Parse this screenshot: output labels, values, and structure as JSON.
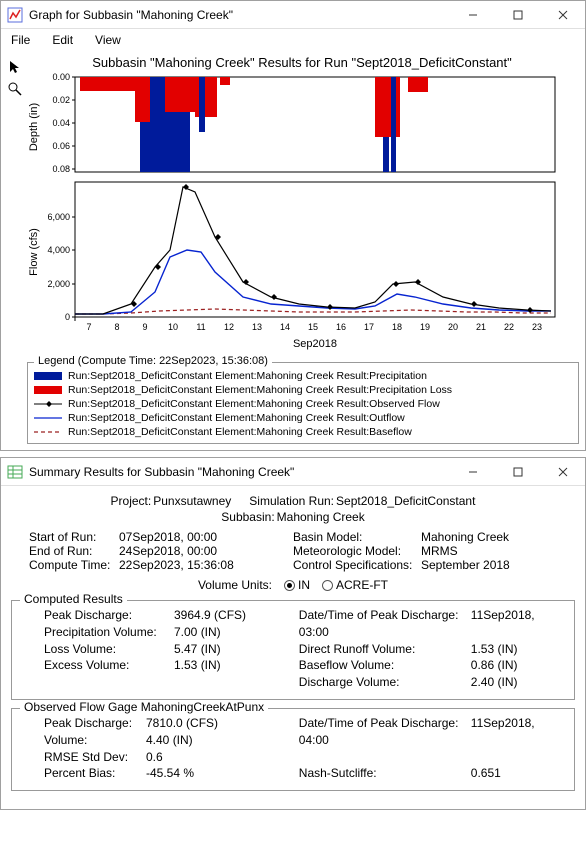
{
  "graph_window": {
    "title": "Graph for Subbasin \"Mahoning Creek\"",
    "menu": {
      "file": "File",
      "edit": "Edit",
      "view": "View"
    },
    "chart_title": "Subbasin \"Mahoning Creek\" Results for Run \"Sept2018_DeficitConstant\"",
    "depth_axis_label": "Depth (in)",
    "flow_axis_label": "Flow (cfs)",
    "x_axis_label": "Sep2018",
    "legend_title": "Legend (Compute Time: 22Sep2023, 15:36:08)",
    "legend": [
      {
        "label": "Run:Sept2018_DeficitConstant Element:Mahoning Creek Result:Precipitation",
        "color": "#001b9b",
        "style": "thick"
      },
      {
        "label": "Run:Sept2018_DeficitConstant Element:Mahoning Creek Result:Precipitation Loss",
        "color": "#e20000",
        "style": "thick"
      },
      {
        "label": "Run:Sept2018_DeficitConstant Element:Mahoning Creek Result:Observed Flow",
        "color": "#000000",
        "style": "diamond"
      },
      {
        "label": "Run:Sept2018_DeficitConstant Element:Mahoning Creek Result:Outflow",
        "color": "#0724d0",
        "style": "line"
      },
      {
        "label": "Run:Sept2018_DeficitConstant Element:Mahoning Creek Result:Baseflow",
        "color": "#9b2020",
        "style": "dash"
      }
    ]
  },
  "summary_window": {
    "title": "Summary Results for Subbasin \"Mahoning Creek\"",
    "header": {
      "project_label": "Project:",
      "project": "Punxsutawney",
      "simrun_label": "Simulation Run:",
      "simrun": "Sept2018_DeficitConstant",
      "subbasin_label": "Subbasin:",
      "subbasin": "Mahoning Creek"
    },
    "runinfo_left": {
      "start_label": "Start of Run:",
      "start": "07Sep2018, 00:00",
      "end_label": "End of Run:",
      "end": "24Sep2018, 00:00",
      "compute_label": "Compute Time:",
      "compute": "22Sep2023, 15:36:08"
    },
    "runinfo_right": {
      "basin_label": "Basin Model:",
      "basin": "Mahoning Creek",
      "met_label": "Meteorologic Model:",
      "met": "MRMS",
      "ctrl_label": "Control Specifications:",
      "ctrl": "September 2018"
    },
    "volume_units": {
      "label": "Volume Units:",
      "in": "IN",
      "acreft": "ACRE-FT"
    },
    "computed": {
      "legend": "Computed Results",
      "left": {
        "peak_d_l": "Peak Discharge:",
        "peak_d": "3964.9 (CFS)",
        "precip_l": "Precipitation Volume:",
        "precip": "7.00 (IN)",
        "loss_l": "Loss Volume:",
        "loss": "5.47 (IN)",
        "excess_l": "Excess Volume:",
        "excess": "1.53 (IN)"
      },
      "right": {
        "dt_l": "Date/Time of Peak Discharge:",
        "dt": "11Sep2018, 03:00",
        "dr_l": "Direct Runoff Volume:",
        "dr": "1.53 (IN)",
        "bf_l": "Baseflow Volume:",
        "bf": "0.86 (IN)",
        "disch_l": "Discharge Volume:",
        "disch": "2.40 (IN)"
      }
    },
    "observed": {
      "legend": "Observed Flow Gage MahoningCreekAtPunx",
      "left": {
        "peak_d_l": "Peak Discharge:",
        "peak_d": "7810.0 (CFS)",
        "vol_l": "Volume:",
        "vol": "4.40 (IN)",
        "rmse_l": "RMSE Std Dev:",
        "rmse": "0.6",
        "pct_l": "Percent Bias:",
        "pct": "-45.54 %"
      },
      "right": {
        "dt_l": "Date/Time of Peak Discharge:",
        "dt": "11Sep2018, 04:00",
        "nash_l": "Nash-Sutcliffe:",
        "nash": "0.651"
      }
    }
  },
  "chart_data": [
    {
      "type": "bar",
      "title": "Precipitation / Loss",
      "ylabel": "Depth (in)",
      "ylim": [
        0,
        0.08
      ],
      "y_inverted": true,
      "x_dates_sep2018": [
        7,
        8,
        9,
        10,
        11,
        12,
        13,
        14,
        15,
        16,
        17,
        18,
        19,
        20,
        21,
        22,
        23
      ],
      "series": [
        {
          "name": "Precipitation",
          "color": "#001b9b",
          "daily_depth_in": [
            0.01,
            0.02,
            0.08,
            0.08,
            0.04,
            0.01,
            0.0,
            0.0,
            0.0,
            0.0,
            0.06,
            0.08,
            0.01,
            0.0,
            0.0,
            0.0,
            0.0
          ]
        },
        {
          "name": "Precipitation Loss",
          "color": "#e20000",
          "daily_depth_in": [
            0.01,
            0.02,
            0.04,
            0.03,
            0.04,
            0.01,
            0.0,
            0.0,
            0.0,
            0.0,
            0.04,
            0.04,
            0.01,
            0.0,
            0.0,
            0.0,
            0.0
          ]
        }
      ]
    },
    {
      "type": "line",
      "title": "Flow",
      "ylabel": "Flow (cfs)",
      "xlabel": "Sep2018",
      "ylim": [
        0,
        8000
      ],
      "x_dates_sep2018": [
        7,
        8,
        9,
        10,
        11,
        12,
        13,
        14,
        15,
        16,
        17,
        18,
        19,
        20,
        21,
        22,
        23
      ],
      "series": [
        {
          "name": "Observed Flow",
          "color": "#000000",
          "marker": "diamond",
          "values": [
            200,
            200,
            800,
            4000,
            7800,
            4500,
            2000,
            1200,
            800,
            700,
            600,
            1500,
            2000,
            1200,
            800,
            600,
            500
          ]
        },
        {
          "name": "Outflow",
          "color": "#0724d0",
          "values": [
            200,
            200,
            600,
            3500,
            3965,
            2500,
            1200,
            800,
            700,
            600,
            550,
            1000,
            1200,
            800,
            600,
            500,
            450
          ]
        },
        {
          "name": "Baseflow",
          "color": "#9b2020",
          "style": "dash",
          "values": [
            200,
            200,
            220,
            280,
            350,
            380,
            380,
            360,
            340,
            320,
            300,
            320,
            340,
            330,
            310,
            300,
            290
          ]
        }
      ]
    }
  ]
}
